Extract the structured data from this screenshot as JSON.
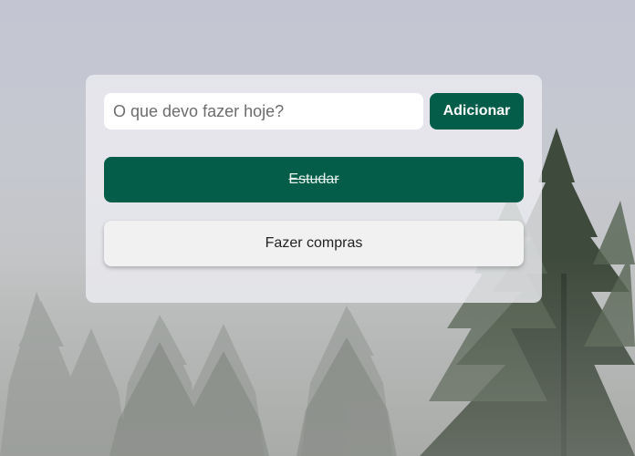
{
  "form": {
    "input_placeholder": "O que devo fazer hoje?",
    "input_value": "",
    "add_button_label": "Adicionar"
  },
  "tasks": [
    {
      "label": "Estudar",
      "done": true
    },
    {
      "label": "Fazer compras",
      "done": false
    }
  ],
  "colors": {
    "accent": "#035d49",
    "task_pending_bg": "#f1f1f1",
    "card_bg": "#ececf0"
  }
}
